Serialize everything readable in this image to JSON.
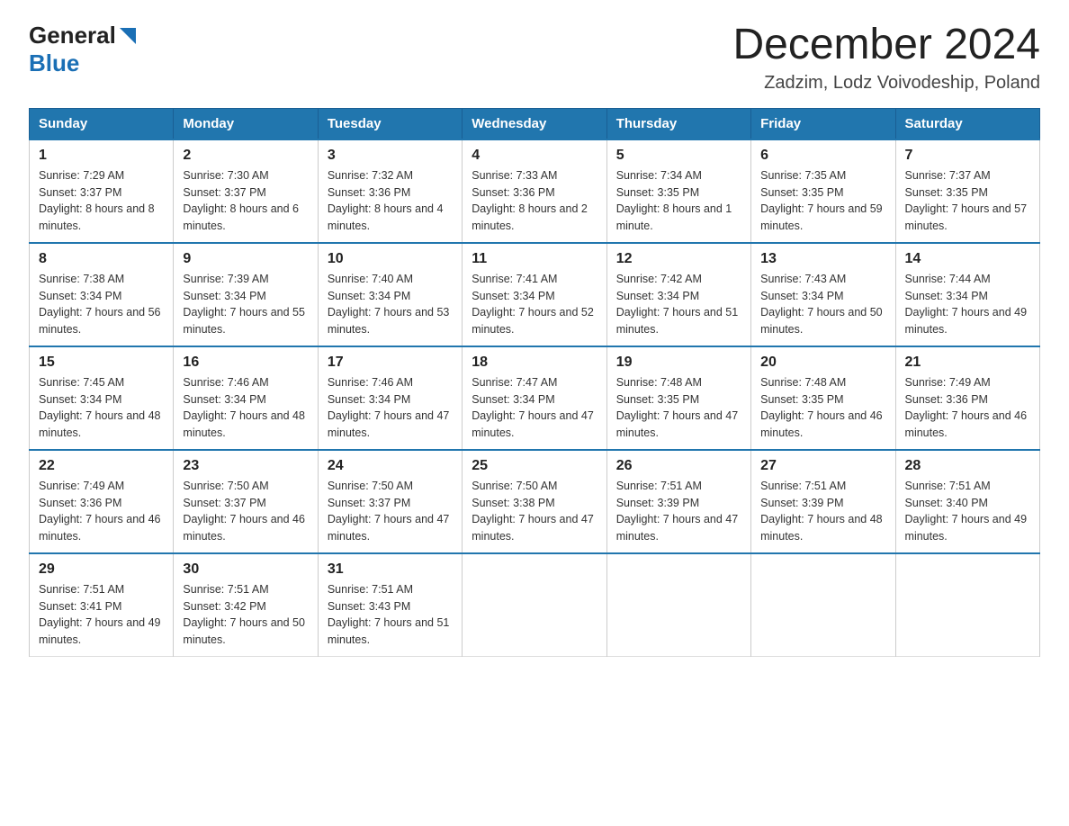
{
  "header": {
    "logo_general": "General",
    "logo_blue": "Blue",
    "month_title": "December 2024",
    "subtitle": "Zadzim, Lodz Voivodeship, Poland"
  },
  "days_of_week": [
    "Sunday",
    "Monday",
    "Tuesday",
    "Wednesday",
    "Thursday",
    "Friday",
    "Saturday"
  ],
  "weeks": [
    [
      {
        "day": "1",
        "sunrise": "7:29 AM",
        "sunset": "3:37 PM",
        "daylight": "8 hours and 8 minutes."
      },
      {
        "day": "2",
        "sunrise": "7:30 AM",
        "sunset": "3:37 PM",
        "daylight": "8 hours and 6 minutes."
      },
      {
        "day": "3",
        "sunrise": "7:32 AM",
        "sunset": "3:36 PM",
        "daylight": "8 hours and 4 minutes."
      },
      {
        "day": "4",
        "sunrise": "7:33 AM",
        "sunset": "3:36 PM",
        "daylight": "8 hours and 2 minutes."
      },
      {
        "day": "5",
        "sunrise": "7:34 AM",
        "sunset": "3:35 PM",
        "daylight": "8 hours and 1 minute."
      },
      {
        "day": "6",
        "sunrise": "7:35 AM",
        "sunset": "3:35 PM",
        "daylight": "7 hours and 59 minutes."
      },
      {
        "day": "7",
        "sunrise": "7:37 AM",
        "sunset": "3:35 PM",
        "daylight": "7 hours and 57 minutes."
      }
    ],
    [
      {
        "day": "8",
        "sunrise": "7:38 AM",
        "sunset": "3:34 PM",
        "daylight": "7 hours and 56 minutes."
      },
      {
        "day": "9",
        "sunrise": "7:39 AM",
        "sunset": "3:34 PM",
        "daylight": "7 hours and 55 minutes."
      },
      {
        "day": "10",
        "sunrise": "7:40 AM",
        "sunset": "3:34 PM",
        "daylight": "7 hours and 53 minutes."
      },
      {
        "day": "11",
        "sunrise": "7:41 AM",
        "sunset": "3:34 PM",
        "daylight": "7 hours and 52 minutes."
      },
      {
        "day": "12",
        "sunrise": "7:42 AM",
        "sunset": "3:34 PM",
        "daylight": "7 hours and 51 minutes."
      },
      {
        "day": "13",
        "sunrise": "7:43 AM",
        "sunset": "3:34 PM",
        "daylight": "7 hours and 50 minutes."
      },
      {
        "day": "14",
        "sunrise": "7:44 AM",
        "sunset": "3:34 PM",
        "daylight": "7 hours and 49 minutes."
      }
    ],
    [
      {
        "day": "15",
        "sunrise": "7:45 AM",
        "sunset": "3:34 PM",
        "daylight": "7 hours and 48 minutes."
      },
      {
        "day": "16",
        "sunrise": "7:46 AM",
        "sunset": "3:34 PM",
        "daylight": "7 hours and 48 minutes."
      },
      {
        "day": "17",
        "sunrise": "7:46 AM",
        "sunset": "3:34 PM",
        "daylight": "7 hours and 47 minutes."
      },
      {
        "day": "18",
        "sunrise": "7:47 AM",
        "sunset": "3:34 PM",
        "daylight": "7 hours and 47 minutes."
      },
      {
        "day": "19",
        "sunrise": "7:48 AM",
        "sunset": "3:35 PM",
        "daylight": "7 hours and 47 minutes."
      },
      {
        "day": "20",
        "sunrise": "7:48 AM",
        "sunset": "3:35 PM",
        "daylight": "7 hours and 46 minutes."
      },
      {
        "day": "21",
        "sunrise": "7:49 AM",
        "sunset": "3:36 PM",
        "daylight": "7 hours and 46 minutes."
      }
    ],
    [
      {
        "day": "22",
        "sunrise": "7:49 AM",
        "sunset": "3:36 PM",
        "daylight": "7 hours and 46 minutes."
      },
      {
        "day": "23",
        "sunrise": "7:50 AM",
        "sunset": "3:37 PM",
        "daylight": "7 hours and 46 minutes."
      },
      {
        "day": "24",
        "sunrise": "7:50 AM",
        "sunset": "3:37 PM",
        "daylight": "7 hours and 47 minutes."
      },
      {
        "day": "25",
        "sunrise": "7:50 AM",
        "sunset": "3:38 PM",
        "daylight": "7 hours and 47 minutes."
      },
      {
        "day": "26",
        "sunrise": "7:51 AM",
        "sunset": "3:39 PM",
        "daylight": "7 hours and 47 minutes."
      },
      {
        "day": "27",
        "sunrise": "7:51 AM",
        "sunset": "3:39 PM",
        "daylight": "7 hours and 48 minutes."
      },
      {
        "day": "28",
        "sunrise": "7:51 AM",
        "sunset": "3:40 PM",
        "daylight": "7 hours and 49 minutes."
      }
    ],
    [
      {
        "day": "29",
        "sunrise": "7:51 AM",
        "sunset": "3:41 PM",
        "daylight": "7 hours and 49 minutes."
      },
      {
        "day": "30",
        "sunrise": "7:51 AM",
        "sunset": "3:42 PM",
        "daylight": "7 hours and 50 minutes."
      },
      {
        "day": "31",
        "sunrise": "7:51 AM",
        "sunset": "3:43 PM",
        "daylight": "7 hours and 51 minutes."
      },
      null,
      null,
      null,
      null
    ]
  ],
  "labels": {
    "sunrise": "Sunrise:",
    "sunset": "Sunset:",
    "daylight": "Daylight:"
  }
}
